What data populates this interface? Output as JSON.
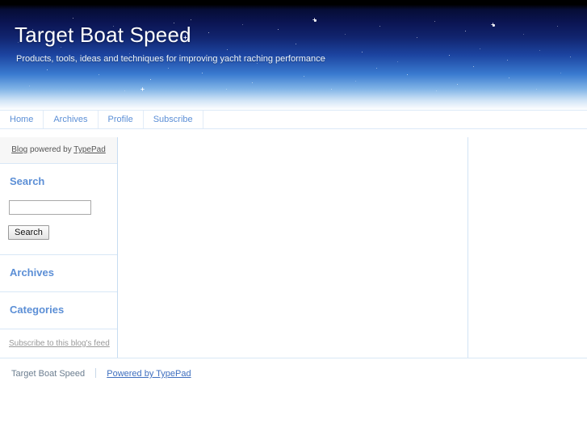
{
  "theme": {
    "link_color": "#5c8fd6",
    "banner_top_color": "#000004",
    "banner_mid_color": "#1c44a0",
    "banner_bottom_color": "#ffffff",
    "border_color": "#d8e7f6",
    "footer_text_color": "#6b7d8f"
  },
  "banner": {
    "title": "Target Boat Speed",
    "tagline": "Products, tools, ideas and techniques for improving yacht raching performance"
  },
  "nav": {
    "items": [
      {
        "label": "Home"
      },
      {
        "label": "Archives"
      },
      {
        "label": "Profile"
      },
      {
        "label": "Subscribe"
      }
    ]
  },
  "sidebar": {
    "powered": {
      "blog_label": "Blog",
      "middle_text": " powered by ",
      "typepad_label": "TypePad"
    },
    "search": {
      "title": "Search",
      "value": "",
      "placeholder": "",
      "button_label": "Search"
    },
    "archives": {
      "title": "Archives"
    },
    "categories": {
      "title": "Categories"
    },
    "feed": {
      "link_label": "Subscribe to this blog's feed"
    }
  },
  "footer": {
    "site_name": "Target Boat Speed",
    "powered_label": "Powered by TypePad"
  }
}
